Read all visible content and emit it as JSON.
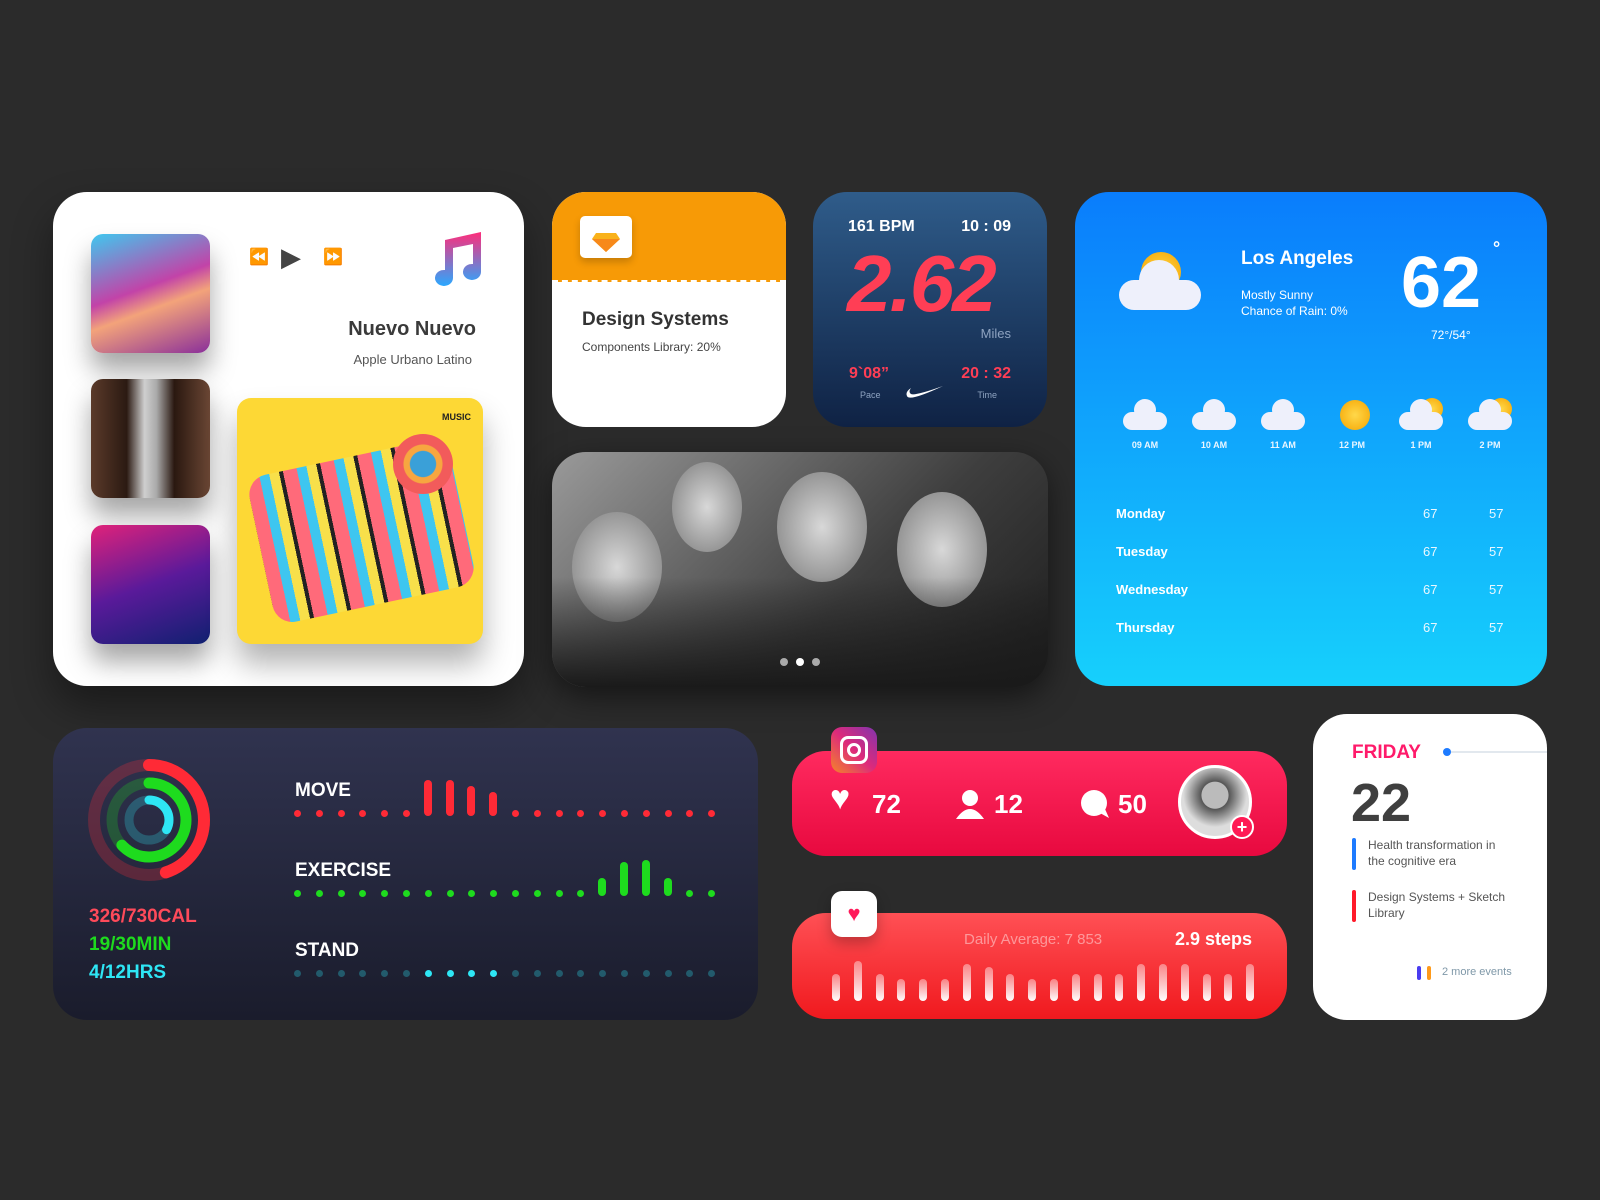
{
  "music": {
    "title": "Nuevo Nuevo",
    "subtitle": "Apple Urbano Latino",
    "badge": "MUSIC",
    "controls": {
      "prev": "⏪",
      "play": "▶",
      "next": "⏩"
    },
    "icon": "music-note-icon"
  },
  "design": {
    "title": "Design Systems",
    "subtitle": "Components Library: 20%",
    "progress": 20,
    "icon": "sketch-folder-icon",
    "accent": "#f79a06"
  },
  "run": {
    "bpm": "161 BPM",
    "clock": "10 : 09",
    "distance": "2.62",
    "unit": "Miles",
    "pace": "9`08”",
    "pace_label": "Pace",
    "time": "20 : 32",
    "time_label": "Time",
    "icon": "nike-swoosh-icon"
  },
  "photo": {
    "slides": 3,
    "active_slide": 1
  },
  "weather": {
    "city": "Los Angeles",
    "condition": "Mostly Sunny",
    "rain": "Chance of Rain: 0%",
    "temp": "62",
    "deg": "°",
    "range": "72°/54°",
    "hourly": [
      {
        "time": "09 AM",
        "icon": "cloud"
      },
      {
        "time": "10 AM",
        "icon": "cloud"
      },
      {
        "time": "11 AM",
        "icon": "cloud"
      },
      {
        "time": "12 PM",
        "icon": "sun"
      },
      {
        "time": "1 PM",
        "icon": "partly-cloudy"
      },
      {
        "time": "2 PM",
        "icon": "partly-cloudy"
      }
    ],
    "daily": [
      {
        "day": "Monday",
        "hi": "67",
        "lo": "57"
      },
      {
        "day": "Tuesday",
        "hi": "67",
        "lo": "57"
      },
      {
        "day": "Wednesday",
        "hi": "67",
        "lo": "57"
      },
      {
        "day": "Thursday",
        "hi": "67",
        "lo": "57"
      }
    ]
  },
  "activity": {
    "cal": "326/730CAL",
    "min": "19/30MIN",
    "hrs": "4/12HRS",
    "move_label": "MOVE",
    "exercise_label": "EXERCISE",
    "stand_label": "STAND",
    "move_progress": 0.45,
    "exercise_progress": 0.63,
    "stand_progress": 0.33,
    "colors": {
      "move": "#ff2a36",
      "exercise": "#1edb1e",
      "stand": "#2ee6f5"
    },
    "move": [
      0,
      0,
      0,
      0,
      0,
      0,
      3,
      3,
      2.5,
      2,
      0,
      0,
      0,
      0,
      0,
      0,
      0,
      0,
      0,
      0
    ],
    "exercise": [
      0,
      0,
      0,
      0,
      0,
      0,
      0,
      0,
      0,
      0,
      0,
      0,
      0,
      0,
      1.5,
      2.8,
      3,
      1.5,
      0,
      0
    ],
    "stand": [
      0,
      0,
      0,
      0,
      0,
      0,
      1,
      1,
      1,
      1,
      0,
      0,
      0,
      0,
      0,
      0,
      0,
      0,
      0,
      0
    ]
  },
  "instagram": {
    "likes": "72",
    "followers": "12",
    "comments": "50"
  },
  "steps": {
    "average": "Daily Average: 7 853",
    "value": "2.9 steps",
    "bars": [
      0.55,
      0.8,
      0.55,
      0.45,
      0.45,
      0.45,
      0.75,
      0.68,
      0.55,
      0.45,
      0.45,
      0.55,
      0.55,
      0.55,
      0.75,
      0.75,
      0.75,
      0.55,
      0.55,
      0.75
    ]
  },
  "calendar": {
    "day": "FRIDAY",
    "date": "22",
    "events": [
      {
        "title": "Health transformation in the cognitive era",
        "color": "#1e7bff"
      },
      {
        "title": "Design Systems + Sketch Library",
        "color": "#ff1a2a"
      }
    ],
    "more": "2 more events",
    "more_colors": [
      "#4a3cf0",
      "#ff9a1a"
    ]
  }
}
